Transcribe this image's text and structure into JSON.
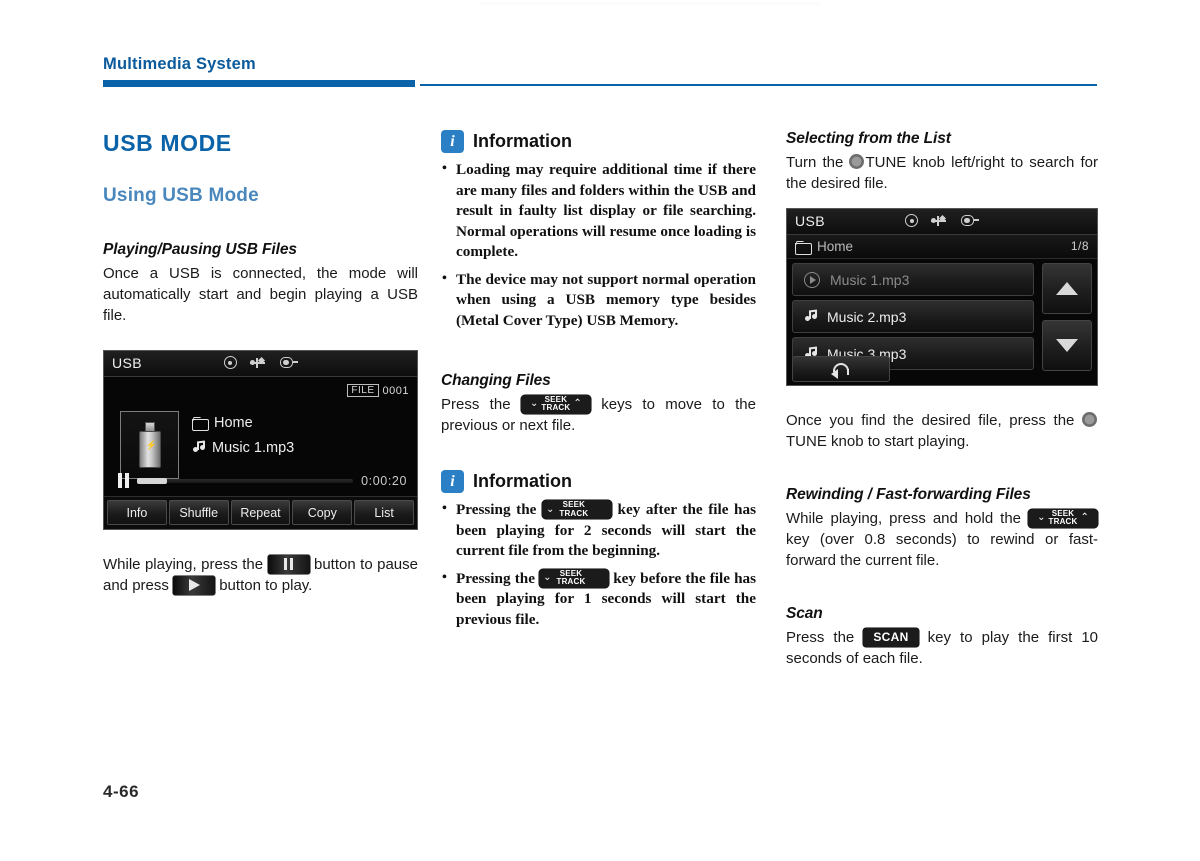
{
  "header": {
    "title": "Multimedia System",
    "accent_color": "#0a62a8"
  },
  "footer": {
    "page_number": "4-66"
  },
  "col1": {
    "chapter_title": "USB MODE",
    "section_title": "Using USB Mode",
    "sub_title": "Playing/Pausing USB Files",
    "paragraph": "Once a USB is connected, the mode will automatically start and begin playing a USB file.",
    "after_text_1": "While playing, press the",
    "after_text_2": "button to pause and press",
    "after_text_3": "button to play."
  },
  "lcd1": {
    "mode_label": "USB",
    "icons": [
      "disc-icon",
      "usb-icon",
      "aux-plug-icon"
    ],
    "file_label": "FILE",
    "file_number": "0001",
    "album_art": "usb-stick-image",
    "folder_name": "Home",
    "track_name": "Music 1.mp3",
    "play_state": "paused",
    "elapsed_time": "0:00:20",
    "buttons": [
      "Info",
      "Shuffle",
      "Repeat",
      "Copy",
      "List"
    ]
  },
  "col2": {
    "info1": {
      "badge": "i",
      "title": "Information",
      "items": [
        "Loading may require additional time if there are many files and folders within the USB and result in faulty list display or file searching. Normal operations will resume once loading is complete.",
        "The device may not support normal operation when using a USB memory type besides (Metal Cover Type) USB Memory."
      ]
    },
    "changing_files": {
      "sub_title": "Changing Files",
      "text_before": "Press the",
      "key_seek": "SEEK",
      "key_track": "TRACK",
      "text_after": "keys to move to the previous or next file."
    },
    "info2": {
      "badge": "i",
      "title": "Information",
      "items": [
        {
          "before": "Pressing the",
          "key_seek": "SEEK",
          "key_track": "TRACK",
          "after": "key after the file has been playing for 2 seconds will start the current file from the beginning."
        },
        {
          "before": "Pressing the",
          "key_seek": "SEEK",
          "key_track": "TRACK",
          "after": "key before the file has been playing for 1 seconds will start the previous file."
        }
      ]
    }
  },
  "col3": {
    "selecting": {
      "sub_title": "Selecting from the List",
      "text_before": "Turn the",
      "knob_label": "TUNE",
      "text_after": "knob left/right to search for the desired file."
    },
    "after_screen": {
      "text_before": "Once you find the desired file, press the",
      "knob_label": "TUNE",
      "text_after": "knob to start playing."
    },
    "rewinding": {
      "sub_title": "Rewinding / Fast-forwarding Files",
      "text_before": "While playing, press and hold the",
      "key_seek": "SEEK",
      "key_track": "TRACK",
      "text_after": "key (over 0.8 seconds) to rewind or fast-forward the current file."
    },
    "scan": {
      "sub_title": "Scan",
      "text_before": "Press the",
      "key_label": "SCAN",
      "text_after": "key to play the first 10 seconds of each file."
    }
  },
  "lcd2": {
    "mode_label": "USB",
    "icons": [
      "disc-icon",
      "usb-icon",
      "aux-plug-icon"
    ],
    "folder_name": "Home",
    "page_count": "1/8",
    "list_items": [
      {
        "name": "Music 1.mp3",
        "state": "playing"
      },
      {
        "name": "Music 2.mp3",
        "state": "idle"
      },
      {
        "name": "Music 3.mp3",
        "state": "idle"
      }
    ],
    "scroll_up": "scroll-up-button",
    "scroll_down": "scroll-down-button",
    "back": "back-button"
  }
}
